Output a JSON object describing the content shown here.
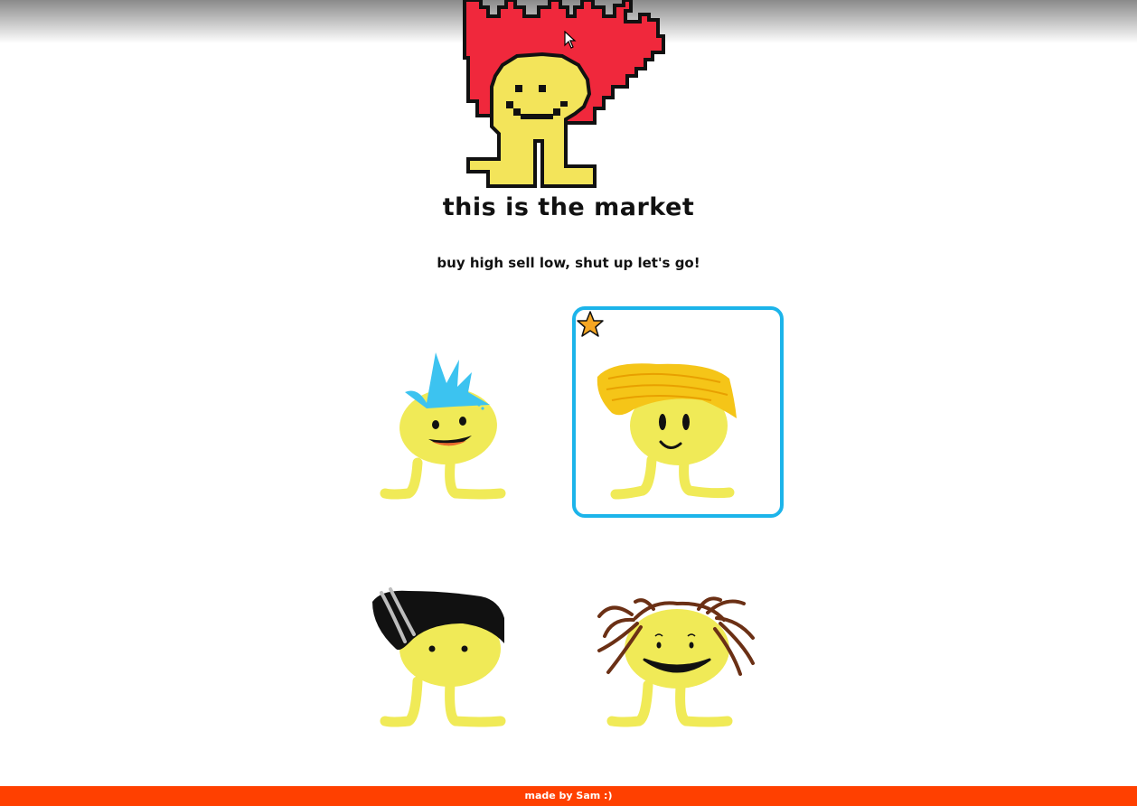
{
  "page": {
    "title": "this is the market",
    "subtitle": "buy high sell low, shut up let's go!"
  },
  "characters": [
    {
      "name": "blue-spiky-hair",
      "hair_color": "#3cc3f0",
      "favorite": false,
      "selected": false
    },
    {
      "name": "yellow-swoop-hair",
      "hair_color": "#f5c518",
      "favorite": true,
      "selected": true
    },
    {
      "name": "black-slick-hair",
      "hair_color": "#111111",
      "favorite": false,
      "selected": false
    },
    {
      "name": "brown-dreadlocks",
      "hair_color": "#6b3015",
      "favorite": false,
      "selected": false
    }
  ],
  "hero": {
    "hair_color": "#f0283c",
    "body_color": "#f3e45a"
  },
  "colors": {
    "accent": "#1cb4ea",
    "footer_bg": "#ff4000",
    "body": "#f0ea57"
  },
  "icons": [
    "star-icon",
    "cursor-icon"
  ],
  "footer": {
    "credit": "made by Sam :)"
  }
}
